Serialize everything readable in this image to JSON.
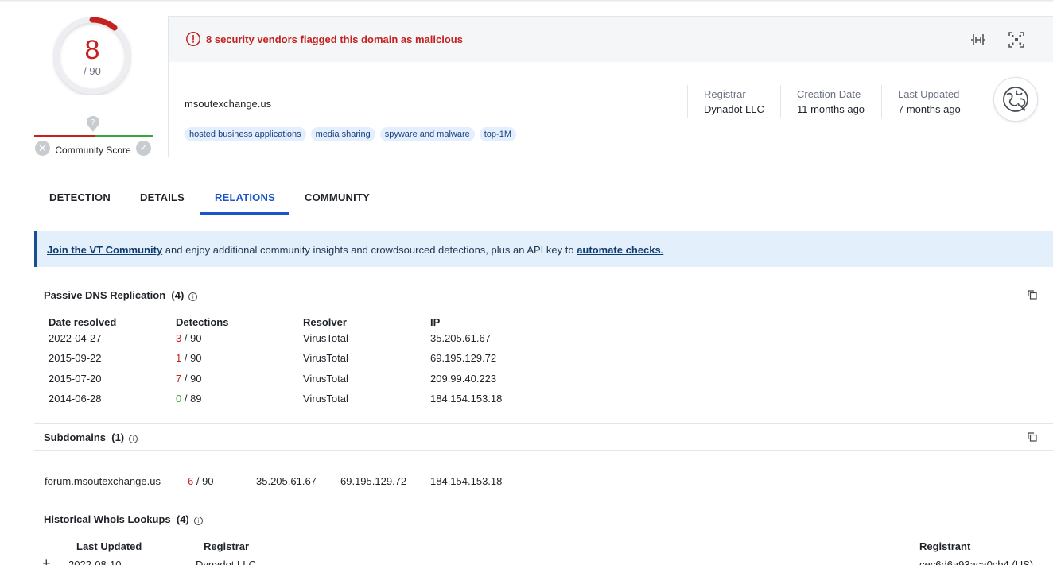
{
  "score": {
    "value": "8",
    "total": "/ 90",
    "community_label": "Community Score"
  },
  "alert": {
    "text": "8 security vendors flagged this domain as malicious"
  },
  "domain": {
    "name": "msoutexchange.us",
    "tags": [
      "hosted business applications",
      "media sharing",
      "spyware and malware",
      "top-1M"
    ]
  },
  "meta": [
    {
      "label": "Registrar",
      "value": "Dynadot LLC"
    },
    {
      "label": "Creation Date",
      "value": "11 months ago"
    },
    {
      "label": "Last Updated",
      "value": "7 months ago"
    }
  ],
  "tabs": [
    "DETECTION",
    "DETAILS",
    "RELATIONS",
    "COMMUNITY"
  ],
  "active_tab": "RELATIONS",
  "banner": {
    "link1": "Join the VT Community",
    "text": " and enjoy additional community insights and crowdsourced detections, plus an API key to ",
    "link2": "automate checks."
  },
  "passive_dns": {
    "title": "Passive DNS Replication",
    "count": "(4)",
    "headers": [
      "Date resolved",
      "Detections",
      "Resolver",
      "IP"
    ],
    "rows": [
      {
        "date": "2022-04-27",
        "det": "3",
        "total": " / 90",
        "resolver": "VirusTotal",
        "ip": "35.205.61.67"
      },
      {
        "date": "2015-09-22",
        "det": "1",
        "total": " / 90",
        "resolver": "VirusTotal",
        "ip": "69.195.129.72"
      },
      {
        "date": "2015-07-20",
        "det": "7",
        "total": " / 90",
        "resolver": "VirusTotal",
        "ip": "209.99.40.223"
      },
      {
        "date": "2014-06-28",
        "det": "0",
        "total": " / 89",
        "resolver": "VirusTotal",
        "ip": "184.154.153.18"
      }
    ]
  },
  "subdomains": {
    "title": "Subdomains",
    "count": "(1)",
    "rows": [
      {
        "name": "forum.msoutexchange.us",
        "det": "6",
        "total": " / 90",
        "ip1": "35.205.61.67",
        "ip2": "69.195.129.72",
        "ip3": "184.154.153.18"
      }
    ]
  },
  "whois": {
    "title": "Historical Whois Lookups",
    "count": "(4)",
    "headers": [
      "Last Updated",
      "Registrar",
      "Registrant"
    ],
    "rows": [
      {
        "date": "2022-08-10",
        "registrar": "Dynadot LLC",
        "registrant": "cec6d6a93aca0cb4 (US)"
      }
    ]
  },
  "colors": {
    "malicious": "#c5221f",
    "clean": "#3aa33a",
    "accent": "#1b56c9"
  }
}
